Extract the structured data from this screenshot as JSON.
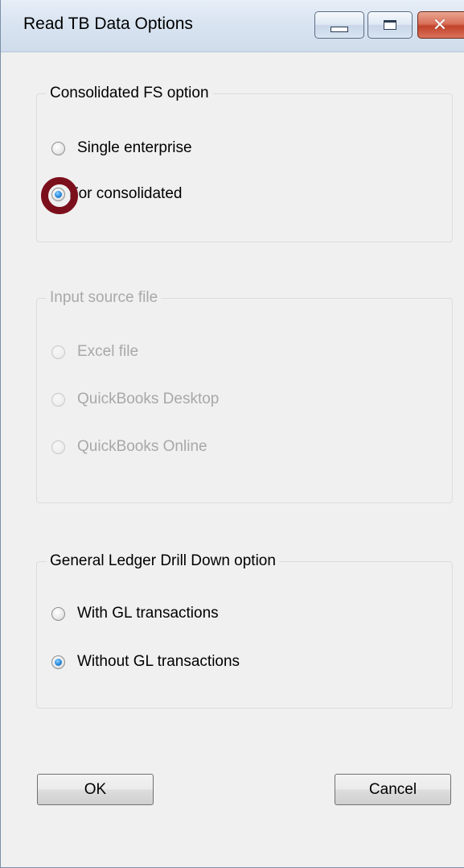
{
  "window": {
    "title": "Read TB Data Options"
  },
  "groups": {
    "consolidated": {
      "legend": "Consolidated FS option",
      "options": [
        {
          "label": "Single enterprise",
          "checked": false
        },
        {
          "label": "For consolidated",
          "checked": true
        }
      ]
    },
    "input_source": {
      "legend": "Input source file",
      "enabled": false,
      "options": [
        {
          "label": "Excel file",
          "checked": false
        },
        {
          "label": "QuickBooks Desktop",
          "checked": false
        },
        {
          "label": "QuickBooks Online",
          "checked": false
        }
      ]
    },
    "drilldown": {
      "legend": "General Ledger Drill Down option",
      "options": [
        {
          "label": "With GL transactions",
          "checked": false
        },
        {
          "label": "Without GL transactions",
          "checked": true
        }
      ]
    }
  },
  "buttons": {
    "ok": "OK",
    "cancel": "Cancel"
  },
  "colors": {
    "highlight_ring": "#7c0f1c",
    "disabled_text": "#a8a8a8"
  }
}
